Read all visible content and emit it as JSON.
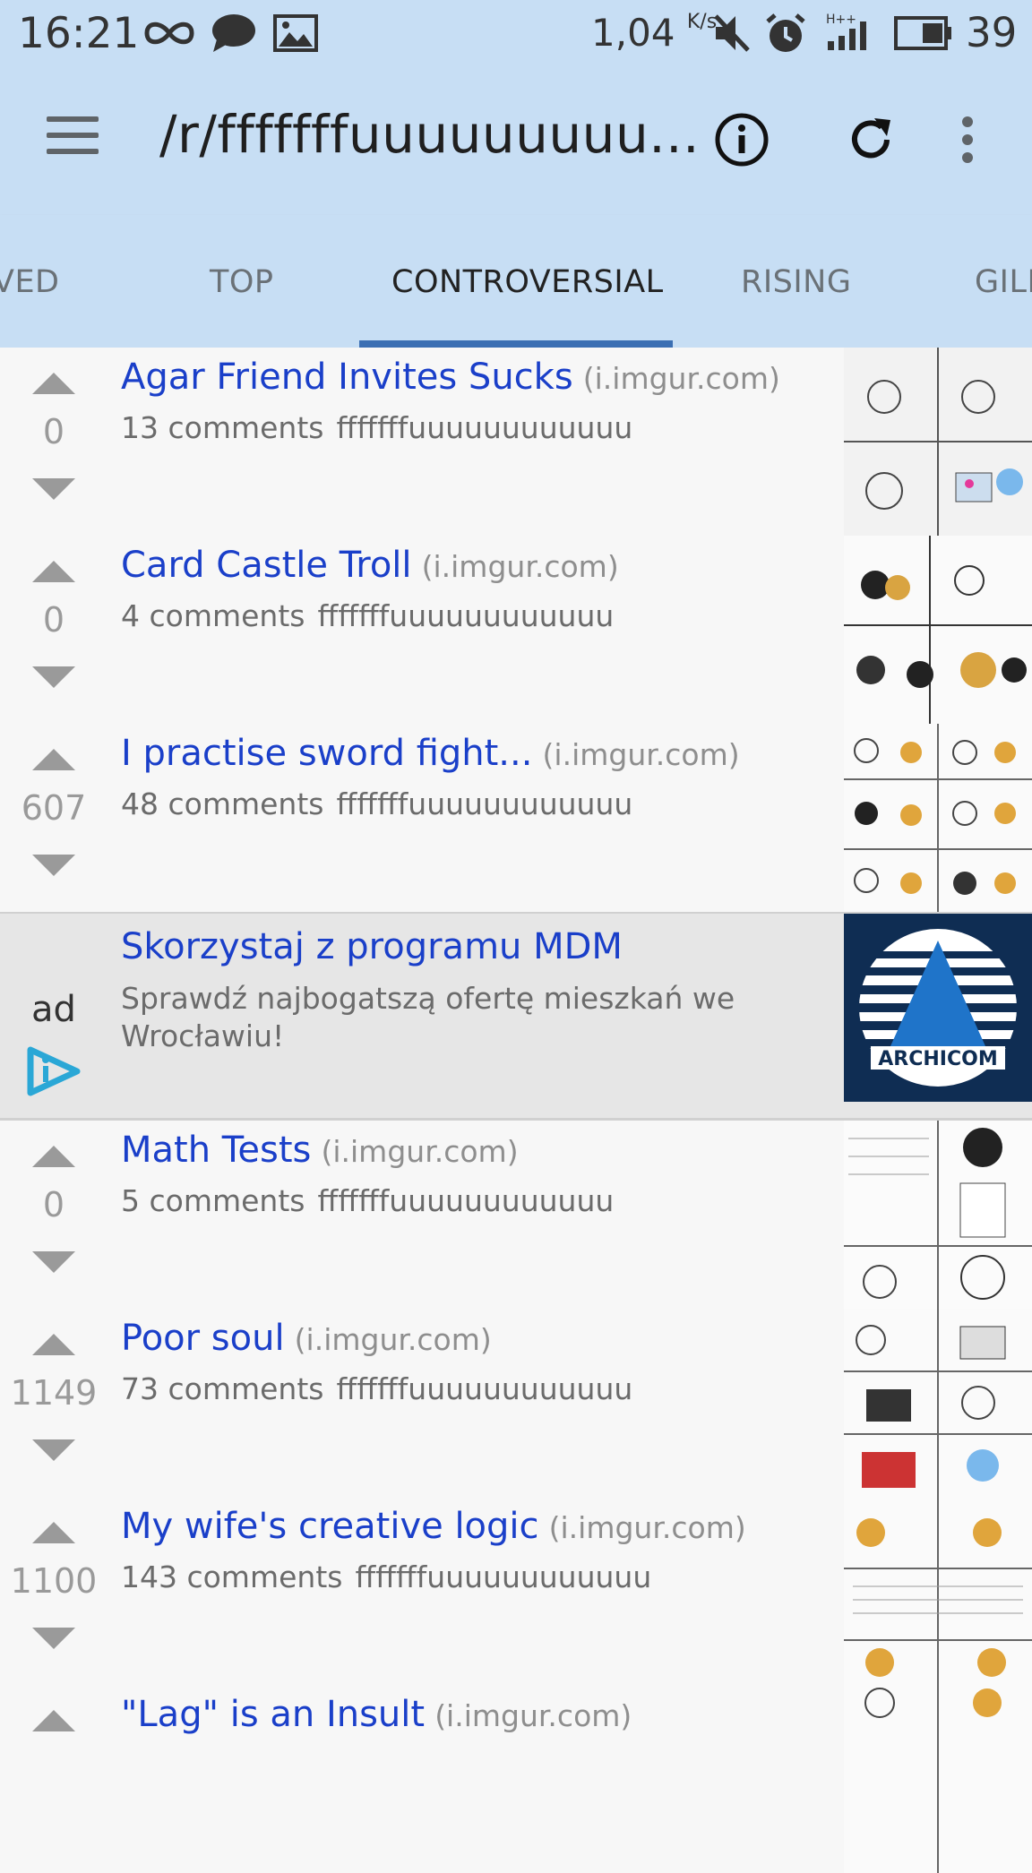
{
  "status_bar": {
    "time": "16:21",
    "speed": "1,04",
    "speed_unit": "K/s",
    "battery": "39",
    "icons": [
      "infinity-icon",
      "chat-bubble-icon",
      "image-icon",
      "mute-icon",
      "alarm-icon",
      "signal-icon",
      "battery-icon"
    ]
  },
  "toolbar": {
    "title": "/r/fffffffuuuuuuuuu...",
    "icons": [
      "menu-icon",
      "info-icon",
      "refresh-icon",
      "more-vert-icon"
    ]
  },
  "tabs": [
    {
      "label": "VED"
    },
    {
      "label": "TOP"
    },
    {
      "label": "CONTROVERSIAL",
      "active": true
    },
    {
      "label": "RISING"
    },
    {
      "label": "GILD"
    }
  ],
  "posts": [
    {
      "score": "0",
      "title": "Agar Friend Invites Sucks",
      "domain": "(i.imgur.com)",
      "comments": "13 comments",
      "subreddit": "fffffffuuuuuuuuuuuu"
    },
    {
      "score": "0",
      "title": "Card Castle Troll",
      "domain": "(i.imgur.com)",
      "comments": "4 comments",
      "subreddit": "fffffffuuuuuuuuuuuu"
    },
    {
      "score": "607",
      "title": "I practise sword fight...",
      "domain": "(i.imgur.com)",
      "comments": "48 comments",
      "subreddit": "fffffffuuuuuuuuuuuu"
    },
    {
      "score": "0",
      "title": "Math Tests",
      "domain": "(i.imgur.com)",
      "comments": "5 comments",
      "subreddit": "fffffffuuuuuuuuuuuu"
    },
    {
      "score": "1149",
      "title": "Poor soul",
      "domain": "(i.imgur.com)",
      "comments": "73 comments",
      "subreddit": "fffffffuuuuuuuuuuuu"
    },
    {
      "score": "1100",
      "title": "My wife's creative logic",
      "domain": "(i.imgur.com)",
      "comments": "143 comments",
      "subreddit": "fffffffuuuuuuuuuuuu"
    },
    {
      "score": "",
      "title": "\"Lag\" is an Insult",
      "domain": "(i.imgur.com)",
      "comments": "",
      "subreddit": ""
    }
  ],
  "ad": {
    "label": "ad",
    "title": "Skorzystaj z programu MDM",
    "description": "Sprawdź najbogatszą ofertę mieszkań we Wrocławiu!",
    "image_text": "ARCHICOM"
  },
  "colors": {
    "header_bg": "#c7def4",
    "link": "#1a3fc9",
    "tab_indicator": "#3b6fb3",
    "ad_bg": "#e6e6e6"
  }
}
